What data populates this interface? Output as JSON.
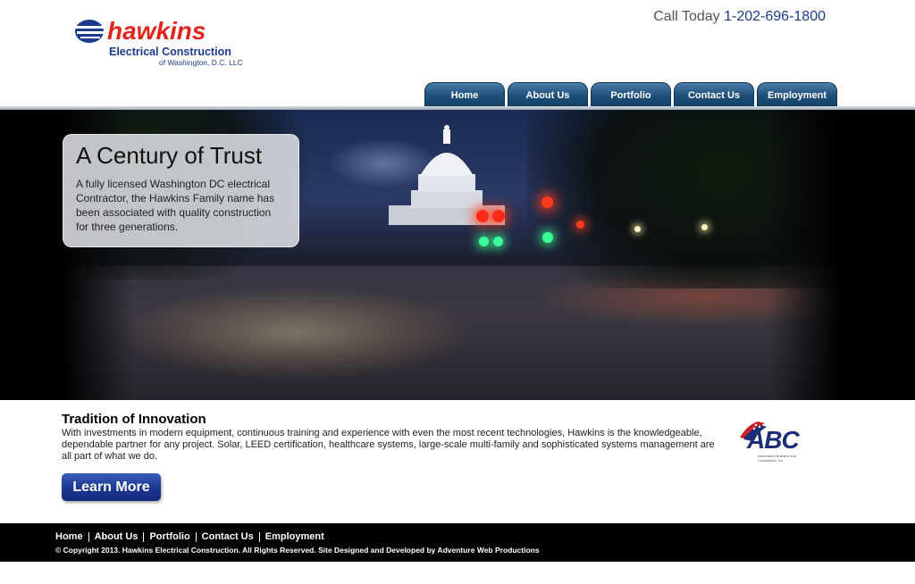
{
  "header": {
    "logo": {
      "brand": "hawkins",
      "tagline": "Electrical Construction",
      "subtagline": "of Washington, D.C. LLC"
    },
    "call_label": "Call Today",
    "phone": "1-202-696-1800"
  },
  "nav": {
    "tabs": [
      {
        "label": "Home"
      },
      {
        "label": "About Us"
      },
      {
        "label": "Portfolio"
      },
      {
        "label": "Contact Us"
      },
      {
        "label": "Employment"
      }
    ]
  },
  "hero": {
    "title": "A Century of Trust",
    "text": "A fully licensed Washington DC electrical Contractor, the Hawkins Family name has been associated with quality construction for three generations."
  },
  "content": {
    "title": "Tradition of Innovation",
    "text": "With investments in modern equipment, continuous training and experience with even the most recent technologies, Hawkins is the knowledgeable, dependable partner for any project. Solar, LEED certification, healthcare systems, large-scale multi-family and sophisticated systems management are all part of what we do.",
    "button_label": "Learn More",
    "partner_logo": {
      "text": "ABC",
      "subtext": "Associated Builders and Contractors, Inc."
    }
  },
  "footer": {
    "links": [
      {
        "label": "Home"
      },
      {
        "label": "About Us"
      },
      {
        "label": "Portfolio"
      },
      {
        "label": "Contact Us"
      },
      {
        "label": "Employment"
      }
    ],
    "copyright": "© Copyright 2013. Hawkins Electrical Construction. All Rights Reserved.  Site Designed and Developed by Adventure Web Productions"
  },
  "colors": {
    "brand_red": "#e3241b",
    "brand_blue": "#1b3c8c",
    "nav_tab": "#1e4f7a",
    "button_blue": "#1c3891",
    "footer_bg": "#000000"
  },
  "icons": [
    "globe-logo-icon",
    "abc-flag-icon"
  ]
}
